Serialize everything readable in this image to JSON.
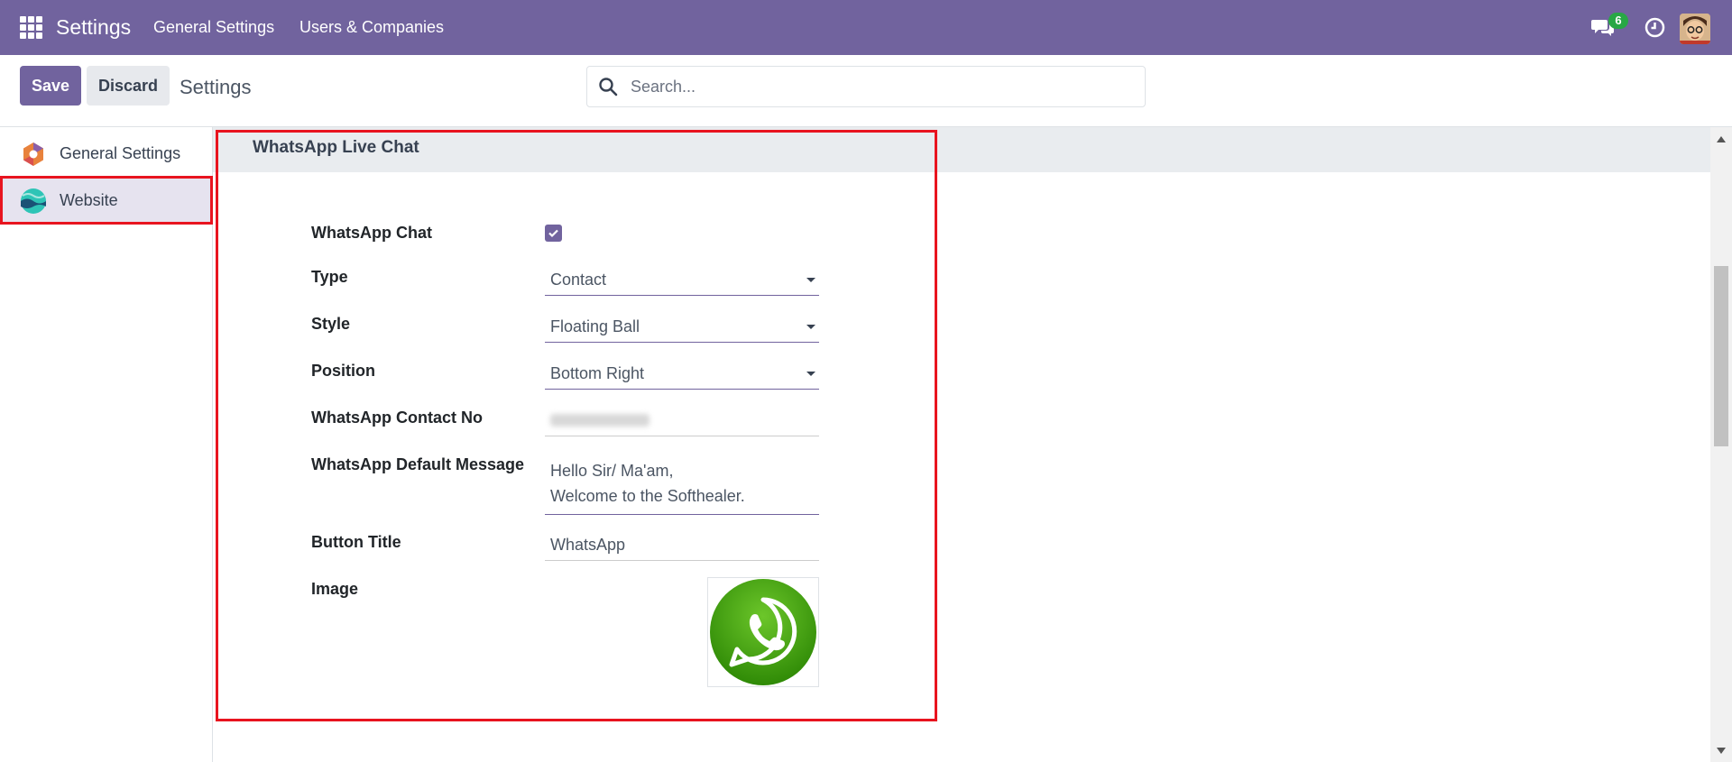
{
  "navbar": {
    "app_title": "Settings",
    "links": [
      "General Settings",
      "Users & Companies"
    ],
    "messages_badge": "6",
    "icons": [
      "apps-grid-icon",
      "chat-icon",
      "clock-icon",
      "avatar"
    ]
  },
  "control_panel": {
    "save_label": "Save",
    "discard_label": "Discard",
    "title": "Settings",
    "search_placeholder": "Search..."
  },
  "sidebar": {
    "items": [
      {
        "label": "General Settings",
        "icon": "general-settings-icon",
        "active": false
      },
      {
        "label": "Website",
        "icon": "website-icon",
        "active": true
      }
    ]
  },
  "section": {
    "title": "WhatsApp Live Chat",
    "fields": {
      "whatsapp_chat": {
        "label": "WhatsApp Chat",
        "checked": true
      },
      "type": {
        "label": "Type",
        "value": "Contact"
      },
      "style": {
        "label": "Style",
        "value": "Floating Ball"
      },
      "position": {
        "label": "Position",
        "value": "Bottom Right"
      },
      "contact_no": {
        "label": "WhatsApp Contact No"
      },
      "default_message": {
        "label": "WhatsApp Default Message",
        "line1": "Hello Sir/ Ma'am,",
        "line2": "Welcome to the Softhealer."
      },
      "button_title": {
        "label": "Button Title",
        "value": "WhatsApp"
      },
      "image": {
        "label": "Image",
        "icon": "whatsapp-logo-icon"
      }
    }
  },
  "colors": {
    "navbar": "#71639e",
    "primary": "#71639e",
    "highlight": "#e8141f",
    "whatsapp_green": "#3e9b0d"
  }
}
